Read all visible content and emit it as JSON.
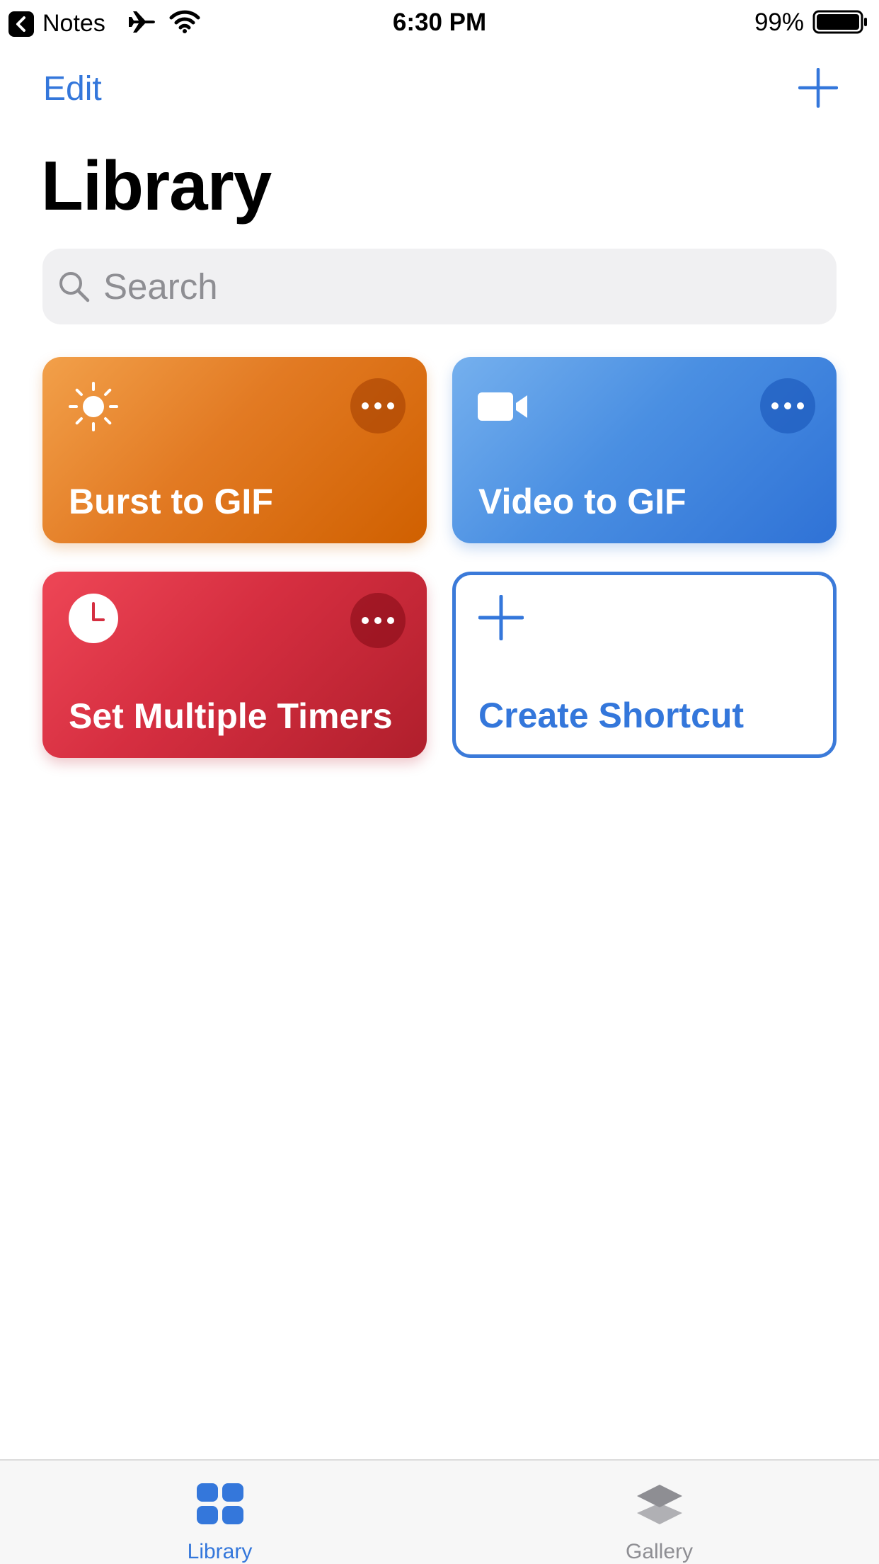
{
  "status_bar": {
    "back_app": "Notes",
    "time": "6:30 PM",
    "battery_percent": "99%",
    "icons": [
      "back-chevron-icon",
      "airplane-icon",
      "wifi-icon",
      "battery-icon"
    ]
  },
  "nav": {
    "edit_label": "Edit",
    "add_icon": "plus-icon"
  },
  "page_title": "Library",
  "search": {
    "placeholder": "Search",
    "icon": "search-icon"
  },
  "shortcuts": [
    {
      "label": "Burst to GIF",
      "icon": "sun-icon",
      "color_start": "#f2a04a",
      "color_end": "#d06000"
    },
    {
      "label": "Video to GIF",
      "icon": "video-camera-icon",
      "color_start": "#75b0ee",
      "color_end": "#2f72d6"
    },
    {
      "label": "Set Multiple Timers",
      "icon": "clock-icon",
      "color_start": "#ee4656",
      "color_end": "#b01f2c"
    },
    {
      "label": "Create Shortcut",
      "icon": "plus-icon",
      "color_start": "#3477db",
      "color_end": "#3477db"
    }
  ],
  "tab_bar": {
    "tabs": [
      {
        "label": "Library",
        "icon": "grid-icon",
        "selected": true
      },
      {
        "label": "Gallery",
        "icon": "layers-icon",
        "selected": false
      }
    ]
  },
  "colors": {
    "accent": "#3477db",
    "inactive": "#8e8e93"
  }
}
